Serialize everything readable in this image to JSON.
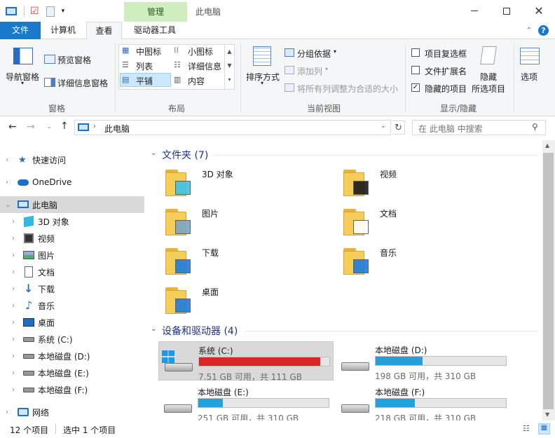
{
  "window": {
    "title": "此电脑",
    "context_tab": "管理"
  },
  "tabs": {
    "file": "文件",
    "computer": "计算机",
    "view": "查看",
    "drive_tools": "驱动器工具"
  },
  "ribbon": {
    "pane": {
      "label": "窗格",
      "nav_pane": "导航窗格",
      "preview": "预览窗格",
      "details": "详细信息窗格"
    },
    "layout": {
      "label": "布局",
      "medium_icons": "中图标",
      "small_icons": "小图标",
      "list": "列表",
      "details": "详细信息",
      "tiles": "平铺",
      "content": "内容"
    },
    "current_view": {
      "label": "当前视图",
      "sort": "排序方式",
      "group_by": "分组依据",
      "add_column": "添加列",
      "fit_columns": "将所有列调整为合适的大小"
    },
    "show_hide": {
      "label": "显示/隐藏",
      "item_checkboxes": "项目复选框",
      "extensions": "文件扩展名",
      "hidden_items": "隐藏的项目",
      "hide_selected_1": "隐藏",
      "hide_selected_2": "所选项目"
    },
    "options": "选项"
  },
  "address": {
    "path": "此电脑",
    "search_placeholder": "在 此电脑 中搜索"
  },
  "nav": {
    "quick_access": "快速访问",
    "onedrive": "OneDrive",
    "this_pc": "此电脑",
    "items": [
      "3D 对象",
      "视频",
      "图片",
      "文档",
      "下载",
      "音乐",
      "桌面",
      "系统 (C:)",
      "本地磁盘 (D:)",
      "本地磁盘 (E:)",
      "本地磁盘 (F:)"
    ],
    "network": "网络"
  },
  "content": {
    "folders_header": "文件夹 (7)",
    "folders": [
      "3D 对象",
      "视频",
      "图片",
      "文档",
      "下载",
      "音乐",
      "桌面"
    ],
    "drives_header": "设备和驱动器 (4)",
    "drives": [
      {
        "name": "系统 (C:)",
        "info": "7.51 GB 可用，共 111 GB",
        "used_fraction": 0.93
      },
      {
        "name": "本地磁盘 (D:)",
        "info": "198 GB 可用，共 310 GB",
        "used_fraction": 0.36
      },
      {
        "name": "本地磁盘 (E:)",
        "info": "251 GB 可用，共 310 GB",
        "used_fraction": 0.19
      },
      {
        "name": "本地磁盘 (F:)",
        "info": "218 GB 可用，共 310 GB",
        "used_fraction": 0.3
      }
    ]
  },
  "status": {
    "count": "12 个项目",
    "selected": "选中 1 个项目"
  }
}
